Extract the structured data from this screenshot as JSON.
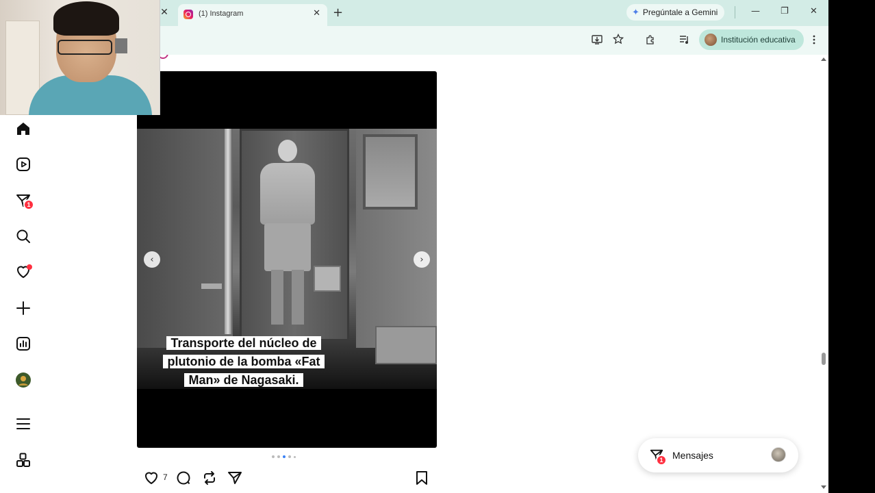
{
  "browser": {
    "tab_title": "(1) Instagram",
    "gemini_label": "Pregúntale a Gemini",
    "profile_label": "Institución educativa"
  },
  "post": {
    "caption_line1": "Transporte del núcleo de",
    "caption_line2": "plutonio de la bomba «Fat",
    "caption_line3": "Man» de Nagasaki.",
    "like_count": "7",
    "carousel_dots": 4,
    "carousel_active_index": 2
  },
  "sidebar": {
    "messages_badge": "1"
  },
  "messages": {
    "label": "Mensajes",
    "badge": "1"
  },
  "colors": {
    "chrome_tab_bg": "#d3ece6",
    "chrome_toolbar_bg": "#eef8f5",
    "notification_red": "#ff3040",
    "profile_chip": "#bfe7dc"
  }
}
